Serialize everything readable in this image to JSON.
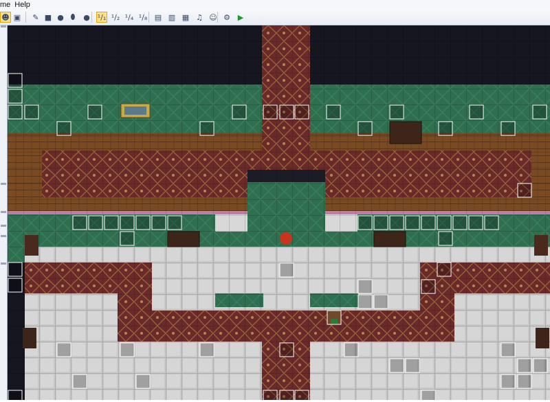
{
  "menu": {
    "items": [
      "me",
      "Help"
    ]
  },
  "toolbar": {
    "buttons": [
      {
        "name": "mode-icon",
        "glyph": "☻",
        "active": true
      },
      {
        "name": "image-icon",
        "glyph": "▣",
        "active": false
      },
      {
        "name": "pencil-icon",
        "glyph": "✎",
        "active": false
      },
      {
        "name": "rectangle-icon",
        "glyph": "■",
        "active": false
      },
      {
        "name": "ellipse-icon",
        "glyph": "●",
        "active": false
      },
      {
        "name": "fill-icon",
        "glyph": "⬮",
        "active": false
      },
      {
        "name": "shadow-pen-icon",
        "glyph": "●",
        "active": false
      },
      {
        "name": "zoom-1-1-icon",
        "glyph": "¹/₁",
        "active": true
      },
      {
        "name": "zoom-1-2-icon",
        "glyph": "¹/₂",
        "active": false
      },
      {
        "name": "zoom-1-4-icon",
        "glyph": "¹/₄",
        "active": false
      },
      {
        "name": "zoom-1-8-icon",
        "glyph": "¹/₈",
        "active": false
      },
      {
        "name": "database-icon",
        "glyph": "▤",
        "active": false
      },
      {
        "name": "plugin-manager-icon",
        "glyph": "▥",
        "active": false
      },
      {
        "name": "sound-test-icon",
        "glyph": "▦",
        "active": false
      },
      {
        "name": "audio-icon",
        "glyph": "♫",
        "active": false
      },
      {
        "name": "character-generator-icon",
        "glyph": "☺",
        "active": false
      },
      {
        "name": "options-icon",
        "glyph": "⚙",
        "active": false
      },
      {
        "name": "playtest-icon",
        "glyph": "▶",
        "active": false
      }
    ]
  },
  "map": {
    "colors": {
      "void": "#15161f",
      "wall_green": "#2f6e4f",
      "wood": "#7a4b22",
      "carpet": "#6b2a2a",
      "tile": "#c9c9c9",
      "tile_dark": "#2a2226",
      "grid": "#000000"
    }
  }
}
